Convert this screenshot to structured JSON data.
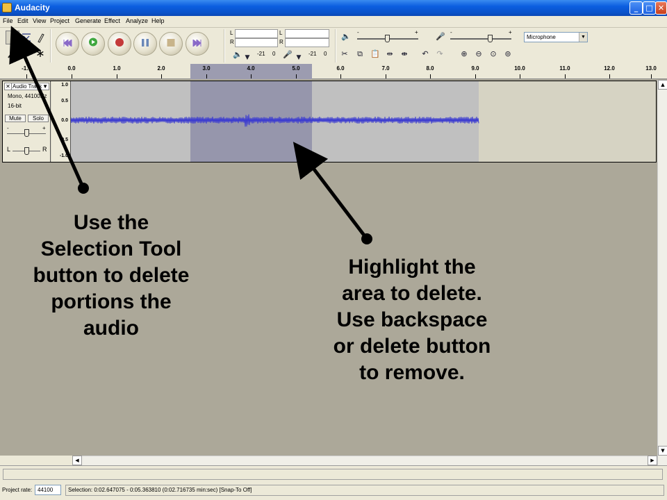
{
  "window": {
    "title": "Audacity",
    "minimize": "_",
    "maximize": "□",
    "close": "✕"
  },
  "menu": [
    "File",
    "Edit",
    "View",
    "Project",
    "Generate",
    "Effect",
    "Analyze",
    "Help"
  ],
  "meters": {
    "left": "L",
    "right": "R",
    "db1": "-21",
    "zero1": "0",
    "db2": "-21",
    "zero2": "0"
  },
  "mixer": {
    "minus": "-",
    "plus": "+",
    "minus2": "-",
    "plus2": "+"
  },
  "input_source": "Microphone",
  "ruler": [
    "-1.0",
    "0.0",
    "1.0",
    "2.0",
    "3.0",
    "4.0",
    "5.0",
    "6.0",
    "7.0",
    "8.0",
    "9.0",
    "10.0",
    "11.0",
    "12.0",
    "13.0"
  ],
  "track": {
    "name": "Audio Track",
    "close": "✕",
    "menu_arrow": "▼",
    "format": "Mono, 44100Hz",
    "bit_depth": "16-bit",
    "mute": "Mute",
    "solo": "Solo",
    "gain_minus": "-",
    "gain_plus": "+",
    "pan_left": "L",
    "pan_right": "R",
    "scale": [
      "1.0",
      "0.5",
      "0.0",
      "-0.5",
      "-1.0"
    ]
  },
  "status": {
    "project_rate_label": "Project rate:",
    "project_rate": "44100",
    "selection": "Selection: 0:02.647075 - 0:05.363810 (0:02.716735 min:sec)  [Snap-To Off]"
  },
  "annotations": {
    "note1": [
      "Use the",
      "Selection Tool",
      "button to delete",
      "portions the",
      "audio"
    ],
    "note2": [
      "Highlight the",
      "area to delete.",
      "Use backspace",
      "or delete button",
      "to remove."
    ]
  },
  "colors": {
    "titlebar": "#0a52c9",
    "waveform": "#3c3cd0",
    "selection": "#9696ac",
    "background": "#aca899"
  }
}
